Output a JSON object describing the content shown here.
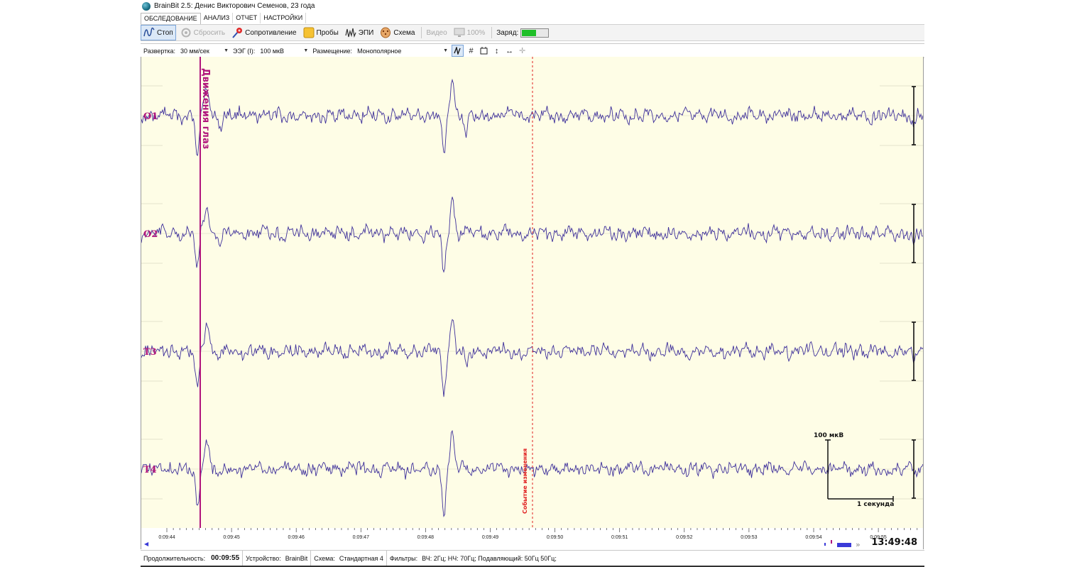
{
  "window": {
    "title": "BrainBit 2.5: Денис Викторович Семенов, 23 года"
  },
  "menu": {
    "tabs": [
      "ОБСЛЕДОВАНИЕ",
      "АНАЛИЗ",
      "ОТЧЕТ",
      "НАСТРОЙКИ"
    ],
    "active": 0
  },
  "toolbar": {
    "stop": "Стоп",
    "reset": "Сбросить",
    "impedance": "Сопротивление",
    "probes": "Пробы",
    "epi": "ЭПИ",
    "scheme": "Схема",
    "video": "Видео",
    "zoom": "100%",
    "charge_label": "Заряд:",
    "charge_level": 0.55,
    "charge_color": "#1fbf28"
  },
  "options": {
    "sweep_label": "Развертка:",
    "sweep_value": "30 мм/сек",
    "eeg_label": "ЭЭГ (I):",
    "eeg_value": "100 мкВ",
    "placement_label": "Размещение:",
    "placement_value": "Монополярное"
  },
  "channels": [
    {
      "name": "O1"
    },
    {
      "name": "O2"
    },
    {
      "name": "T3"
    },
    {
      "name": "T4"
    }
  ],
  "markers": {
    "eye_movement": {
      "label": "Движения глаз",
      "color": "#b0157c",
      "time": "0:09:44.6"
    },
    "event": {
      "label": "Событие изменения",
      "color": "#e02020",
      "time": "0:09:49.6"
    }
  },
  "scale": {
    "amplitude": "100 мкВ",
    "duration": "1 секунда"
  },
  "timeline": {
    "ticks": [
      "0:09:44",
      "0:09:45",
      "0:09:46",
      "0:09:47",
      "0:09:48",
      "0:09:49",
      "0:09:50",
      "0:09:51",
      "0:09:52",
      "0:09:53",
      "0:09:54",
      "0:09:55"
    ],
    "clock": "13:49:48"
  },
  "status": {
    "duration_label": "Продолжительность:",
    "duration_value": "00:09:55",
    "device_label": "Устройство:",
    "device_value": "BrainBit",
    "scheme_label": "Схема:",
    "scheme_value": "Стандартная 4",
    "filters_label": "Фильтры:",
    "filters_value": "ВЧ: 2Гц; НЧ: 70Гц; Подавляющий: 50Гц 50Гц;"
  },
  "colors": {
    "signal": "#3d2f9a",
    "channel_label": "#b0157c",
    "background": "#fefde6"
  }
}
